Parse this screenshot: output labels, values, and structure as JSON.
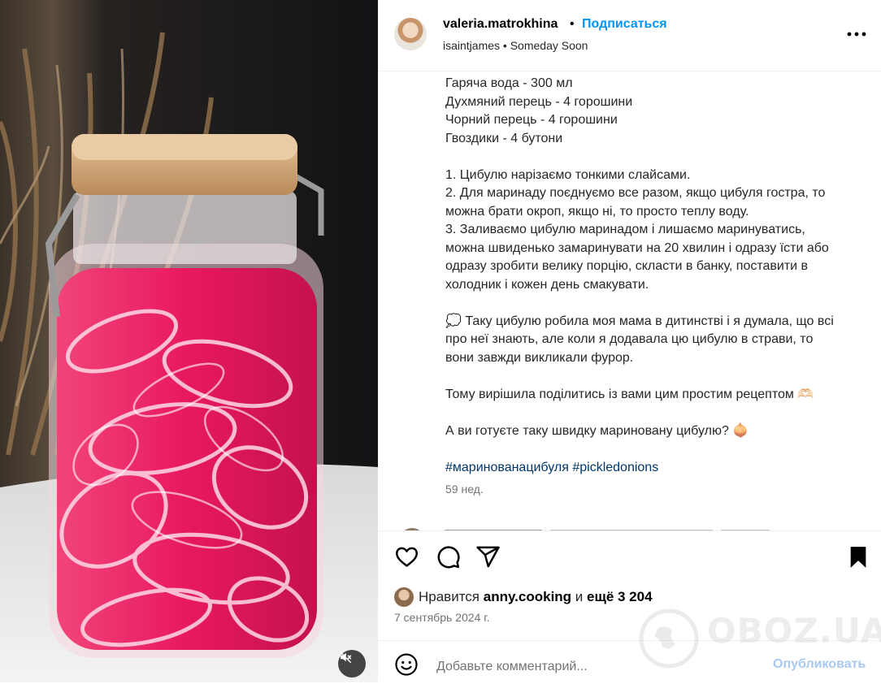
{
  "post": {
    "username": "valeria.matrokhina",
    "separator": "•",
    "follow_label": "Подписаться",
    "audio": "isaintjames • Someday Soon"
  },
  "caption": {
    "ingredients": [
      "Гаряча вода - 300 мл",
      "Духмяний перець - 4 горошини",
      "Чорний перець - 4 горошини",
      "Гвоздики - 4 бутони"
    ],
    "steps": [
      "1. Цибулю нарізаємо тонкими слайсами.",
      "2. Для маринаду поєднуємо все разом, якщо цибуля гостра, то",
      "можна брати окроп, якщо ні, то просто теплу воду.",
      "3. Заливаємо цибулю маринадом і лишаємо маринуватись,",
      "можна швиденько замаринувати на 20 хвилин і одразу їсти або",
      "одразу зробити велику порцію, скласти в банку, поставити в",
      "холодник і кожен день смакувати."
    ],
    "story": [
      "💭 Таку цибулю робила моя мама в дитинстві і я думала, що всі",
      "про неї знають, але коли я додавала цю цибулю в страви, то",
      "вони завжди викликали фурор."
    ],
    "share_line": "Тому вирішила поділитись із вами цим простим рецептом 🫶🏻",
    "question": "А ви готуєте таку швидку мариновану цибулю? 🧅",
    "hashtags": [
      "#маринованацибуля",
      "#pickledonions"
    ],
    "age": "59 нед."
  },
  "engagement": {
    "liked_by_prefix": "Нравится",
    "liked_by_user": "anny.cooking",
    "liked_by_middle": "и",
    "liked_by_rest": "ещё 3 204",
    "date": "7 сентябрь 2024 г."
  },
  "comment_box": {
    "placeholder": "Добавьте комментарий...",
    "publish_label": "Опубликовать"
  },
  "watermark": "OBOZ.UA",
  "icons": {
    "like": "heart-icon",
    "comment": "comment-icon",
    "share": "share-icon",
    "save": "bookmark-icon",
    "more": "more-icon",
    "emoji": "smiley-icon",
    "mute": "muted-speaker-icon"
  },
  "colors": {
    "accent": "#0095f6",
    "hashtag": "#00376b",
    "secondary_text": "#737373",
    "publish_disabled": "#a9c9f1"
  }
}
